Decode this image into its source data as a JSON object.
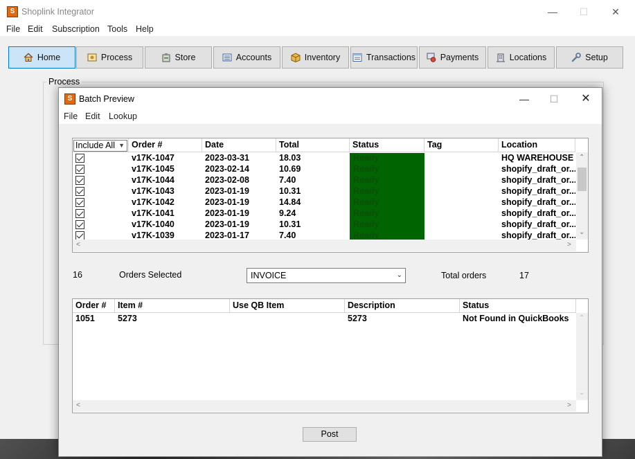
{
  "app": {
    "title": "Shoplink Integrator",
    "menu": [
      "File",
      "Edit",
      "Subscription",
      "Tools",
      "Help"
    ],
    "tabs": [
      {
        "label": "Home",
        "icon": "home-icon",
        "active": true
      },
      {
        "label": "Process",
        "icon": "process-icon",
        "active": false
      },
      {
        "label": "Store",
        "icon": "store-icon",
        "active": false
      },
      {
        "label": "Accounts",
        "icon": "accounts-icon",
        "active": false
      },
      {
        "label": "Inventory",
        "icon": "inventory-icon",
        "active": false
      },
      {
        "label": "Transactions",
        "icon": "transactions-icon",
        "active": false
      },
      {
        "label": "Payments",
        "icon": "payments-icon",
        "active": false
      },
      {
        "label": "Locations",
        "icon": "locations-icon",
        "active": false
      },
      {
        "label": "Setup",
        "icon": "setup-icon",
        "active": false
      }
    ],
    "process_group_label": "Process"
  },
  "dialog": {
    "title": "Batch Preview",
    "menu": [
      "File",
      "Edit",
      "Lookup"
    ],
    "orders_grid": {
      "filter_label": "Include All",
      "columns": [
        "Order #",
        "Date",
        "Total",
        "Status",
        "Tag",
        "Location"
      ],
      "rows": [
        {
          "checked": true,
          "order": "v17K-1047",
          "date": "2023-03-31",
          "total": "18.03",
          "status": "Ready",
          "tag": "",
          "location": "HQ WAREHOUSE"
        },
        {
          "checked": true,
          "order": "v17K-1045",
          "date": "2023-02-14",
          "total": "10.69",
          "status": "Ready",
          "tag": "",
          "location": "shopify_draft_or..."
        },
        {
          "checked": true,
          "order": "v17K-1044",
          "date": "2023-02-08",
          "total": "7.40",
          "status": "Ready",
          "tag": "",
          "location": "shopify_draft_or..."
        },
        {
          "checked": true,
          "order": "v17K-1043",
          "date": "2023-01-19",
          "total": "10.31",
          "status": "Ready",
          "tag": "",
          "location": "shopify_draft_or..."
        },
        {
          "checked": true,
          "order": "v17K-1042",
          "date": "2023-01-19",
          "total": "14.84",
          "status": "Ready",
          "tag": "",
          "location": "shopify_draft_or..."
        },
        {
          "checked": true,
          "order": "v17K-1041",
          "date": "2023-01-19",
          "total": "9.24",
          "status": "Ready",
          "tag": "",
          "location": "shopify_draft_or..."
        },
        {
          "checked": true,
          "order": "v17K-1040",
          "date": "2023-01-19",
          "total": "10.31",
          "status": "Ready",
          "tag": "",
          "location": "shopify_draft_or..."
        },
        {
          "checked": true,
          "order": "v17K-1039",
          "date": "2023-01-17",
          "total": "7.40",
          "status": "Ready",
          "tag": "",
          "location": "shopify_draft_or..."
        }
      ]
    },
    "summary": {
      "selected_count": "16",
      "selected_label": "Orders Selected",
      "transaction_type": "INVOICE",
      "total_label": "Total orders",
      "total_value": "17"
    },
    "items_grid": {
      "columns": [
        "Order #",
        "Item #",
        "Use QB Item",
        "Description",
        "Status"
      ],
      "rows": [
        {
          "order": "1051",
          "item": "5273",
          "qb_item": "",
          "description": "5273",
          "status": "Not Found in QuickBooks"
        }
      ]
    },
    "post_label": "Post",
    "colors": {
      "status_ready_bg": "#006400",
      "active_tab": "#cce4f7"
    }
  }
}
